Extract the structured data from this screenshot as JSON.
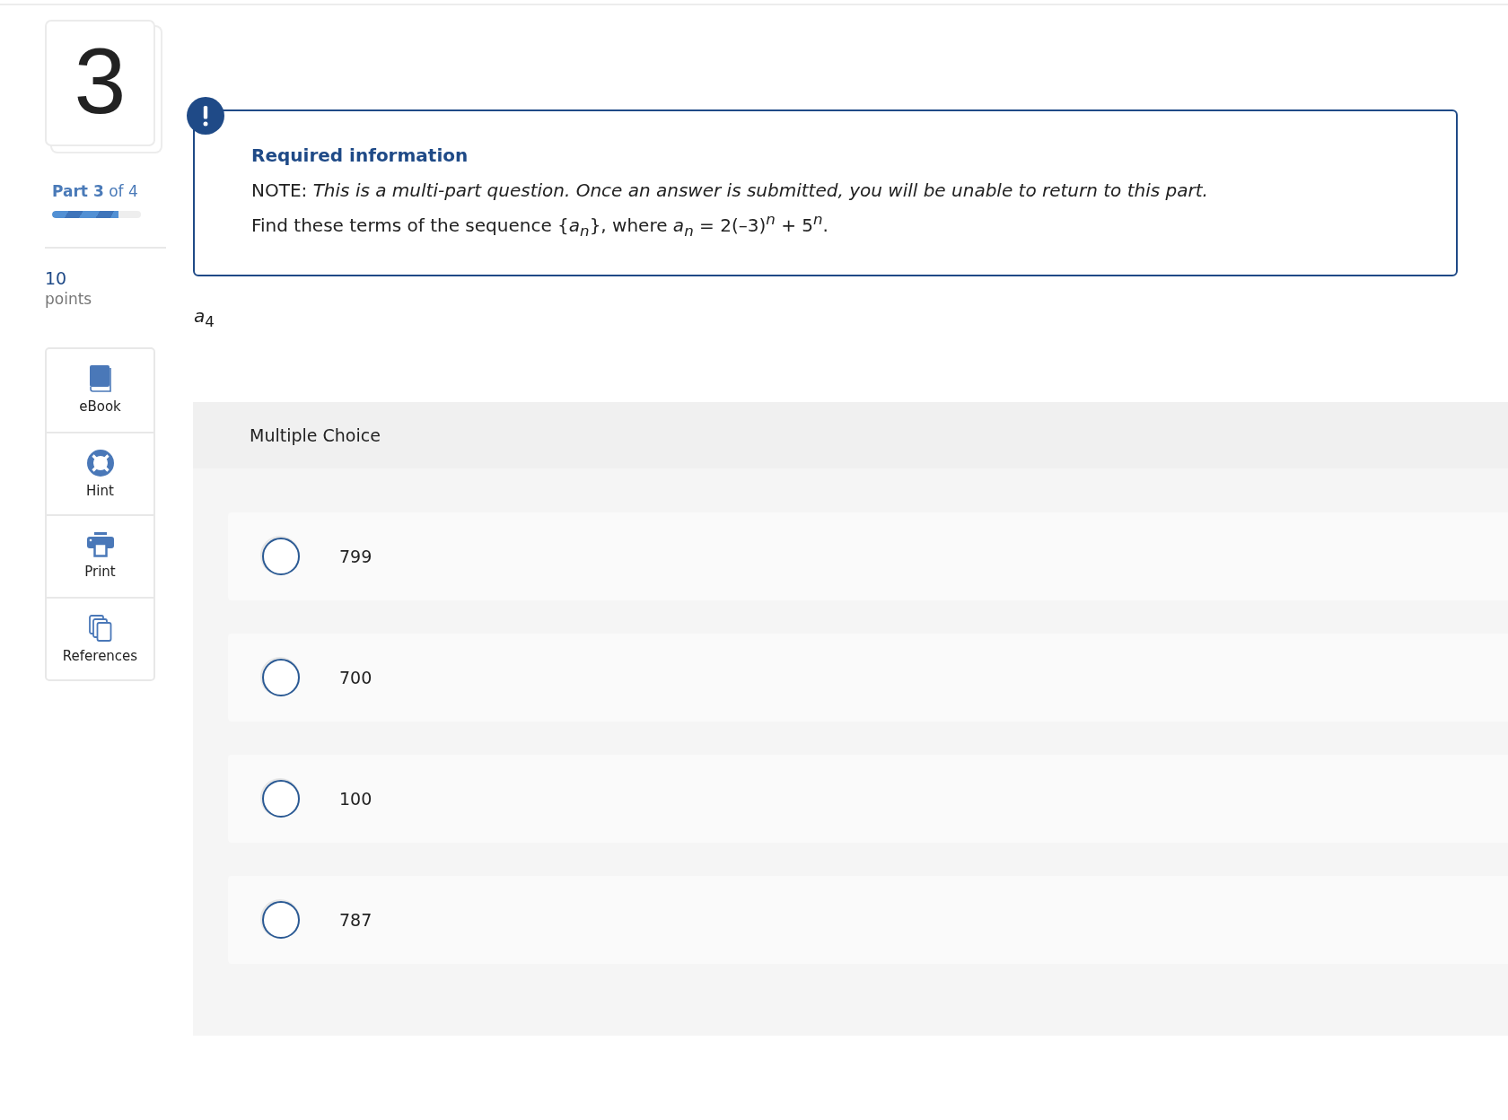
{
  "question_number": "3",
  "progress": {
    "label": "**Part 3** of 4",
    "level": 0.75
  },
  "points": {
    "value": "10",
    "label": "points"
  },
  "tools": [
    {
      "kind": "ebook",
      "label": "eBook"
    },
    {
      "kind": "hint",
      "label": "Hint"
    },
    {
      "kind": "print",
      "label": "Print"
    },
    {
      "kind": "references",
      "label": "References"
    }
  ],
  "notice": {
    "title": "Required information",
    "note": "NOTE: *This is a multi-part question. Once an answer is submitted, you will be unable to return to this part.*",
    "prompt": "Find these terms of the sequence {*a*$_{n}$}, where *a*$_{n}$ = 2(–3)$^{n}$ + 5$^{n}$."
  },
  "term": "*a*$_{4}$",
  "choices": {
    "heading": "Multiple Choice",
    "options": [
      {
        "label": "799",
        "selected": false
      },
      {
        "label": "700",
        "selected": false
      },
      {
        "label": "100",
        "selected": false
      },
      {
        "label": "787",
        "selected": false
      }
    ]
  }
}
